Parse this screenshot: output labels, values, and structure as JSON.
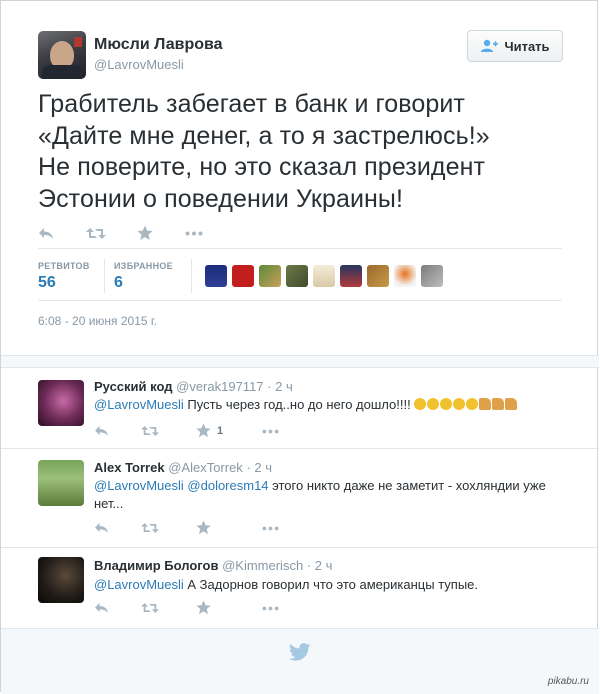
{
  "tweet": {
    "author_name": "Мюсли Лаврова",
    "author_handle": "@LavrovMuesli",
    "follow_label": "Читать",
    "text_lines": [
      "Грабитель забегает в банк и говорит",
      "«Дайте мне денег, а то я застрелюсь!»",
      "Не поверите, но это сказал президент",
      "Эстонии о поведении Украины!"
    ],
    "stats": {
      "retweets_label": "РЕТВИТОВ",
      "retweets_value": "56",
      "favorites_label": "ИЗБРАННОЕ",
      "favorites_value": "6"
    },
    "timestamp": "6:08 - 20 июня 2015 г."
  },
  "icons": {
    "reply": "reply-icon",
    "retweet": "retweet-icon",
    "favorite": "star-icon",
    "more": "more-icon",
    "follow": "add-user-icon",
    "bird": "twitter-bird-icon"
  },
  "colors": {
    "link": "#2a7bb6",
    "muted": "#8899a6",
    "text": "#292f33",
    "divider": "#e1e8ed",
    "bird": "#a5c9e3"
  },
  "replies": [
    {
      "name": "Русский код",
      "handle": "@verak197117",
      "time": "· 2 ч",
      "mention": "@LavrovMuesli",
      "mention2": "",
      "text": " Пусть через год..но до него дошло!!!!",
      "fav_count": "1"
    },
    {
      "name": "Alex Torrek",
      "handle": "@AlexTorrek",
      "time": "· 2 ч",
      "mention": "@LavrovMuesli",
      "mention2": "@doloresm14",
      "text": " этого никто даже не заметит - хохляндии уже нет...",
      "fav_count": ""
    },
    {
      "name": "Владимир Бологов",
      "handle": "@Kimmerisch",
      "time": "· 2 ч",
      "mention": "@LavrovMuesli",
      "mention2": "",
      "text": " А Задорнов говорил что это американцы тупые.",
      "fav_count": ""
    }
  ],
  "watermark": "pikabu.ru"
}
